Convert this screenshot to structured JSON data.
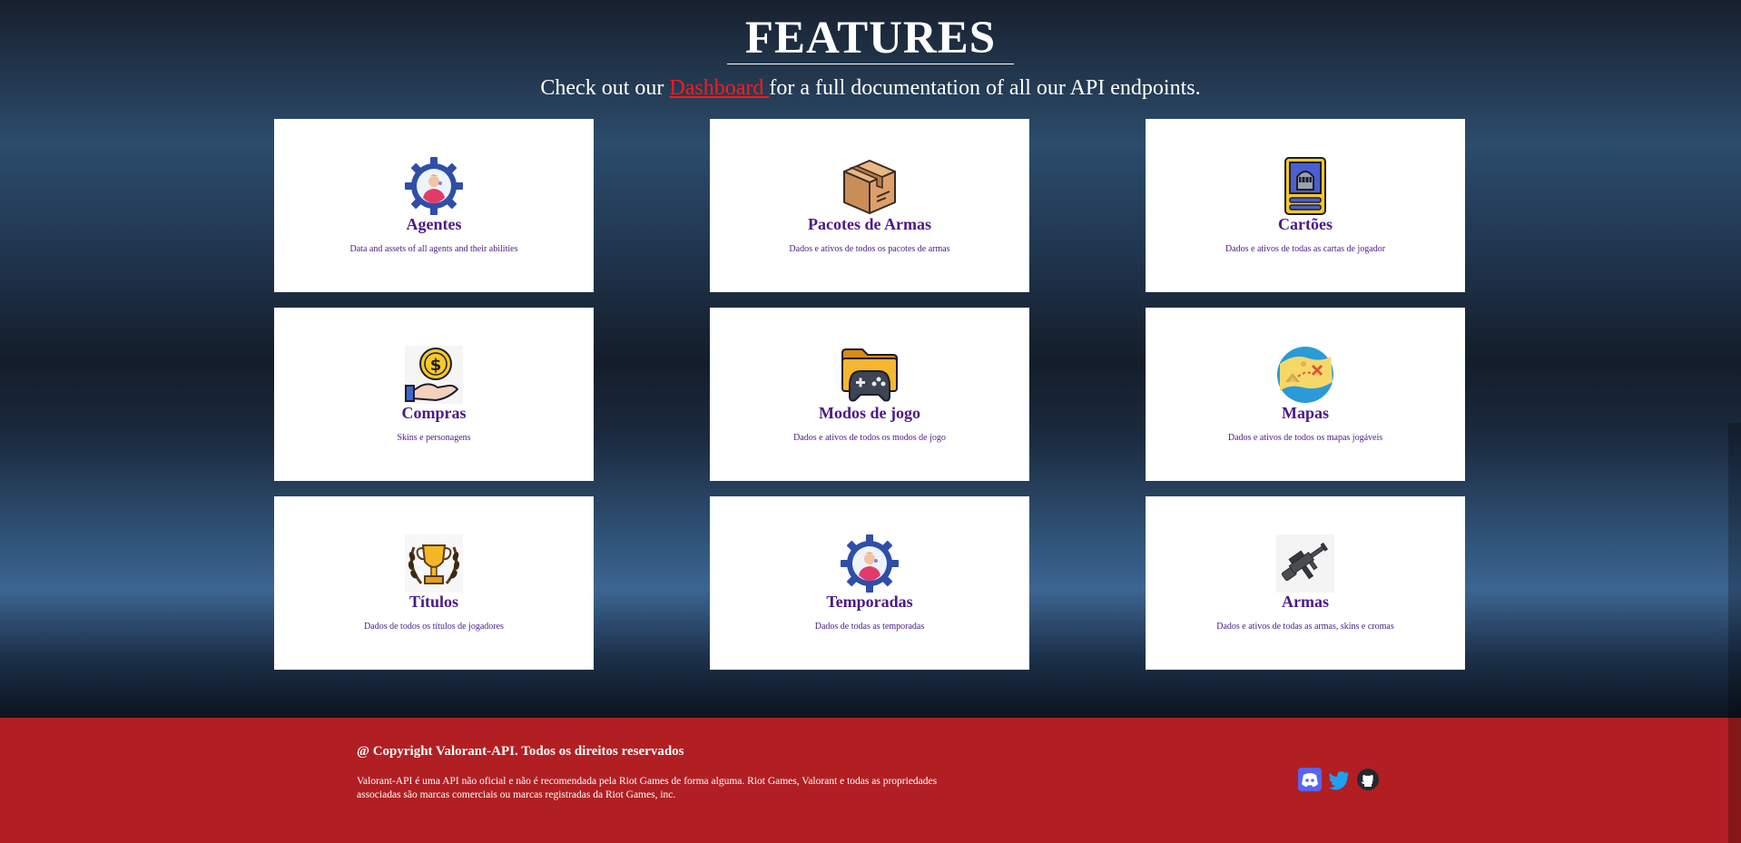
{
  "header": {
    "title": "FEATURES",
    "subtitle_before": "Check out our ",
    "subtitle_link": "Dashboard ",
    "subtitle_after": "for a full documentation of all our API endpoints."
  },
  "features": [
    {
      "title": "Agentes",
      "desc": "Data and assets of all agents and their abilities",
      "icon": "agent-gear-icon"
    },
    {
      "title": "Pacotes de Armas",
      "desc": "Dados e ativos de todos os pacotes de armas",
      "icon": "package-box-icon"
    },
    {
      "title": "Cartões",
      "desc": "Dados e ativos de todas as cartas de jogador",
      "icon": "player-card-icon"
    },
    {
      "title": "Compras",
      "desc": "Skins e personagens",
      "icon": "coin-hand-icon"
    },
    {
      "title": "Modos de jogo",
      "desc": "Dados e ativos de todos os modos de jogo",
      "icon": "gamepad-folder-icon"
    },
    {
      "title": "Mapas",
      "desc": "Dados e ativos de todos os mapas jogáveis",
      "icon": "treasure-map-icon"
    },
    {
      "title": "Títulos",
      "desc": "Dados de todos os títulos de jogadores",
      "icon": "trophy-icon"
    },
    {
      "title": "Temporadas",
      "desc": "Dados de todas as temporadas",
      "icon": "agent-gear-icon"
    },
    {
      "title": "Armas",
      "desc": "Dados e ativos de todas as armas, skins e cromas",
      "icon": "rifle-icon"
    }
  ],
  "footer": {
    "copyright": "@ Copyright Valorant-API. Todos os direitos reservados",
    "disclaimer": "Valorant-API é uma API não oficial e não é recomendada pela Riot Games de forma alguma. Riot Games, Valorant e todas as propriedades associadas são marcas comerciais ou marcas registradas da Riot Games, inc."
  },
  "social": [
    "discord-icon",
    "twitter-icon",
    "github-icon"
  ],
  "colors": {
    "card_text": "#4b1a86",
    "footer_bg": "#b11f22",
    "link": "#ff1a1a"
  }
}
